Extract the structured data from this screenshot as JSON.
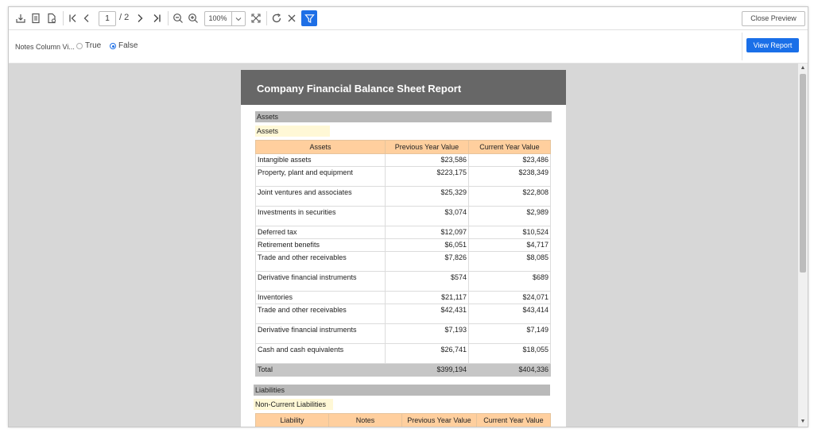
{
  "toolbar": {
    "page_current": "1",
    "page_total": "/ 2",
    "zoom": "100%",
    "close_preview": "Close Preview"
  },
  "parameters": {
    "label": "Notes Column Vi...",
    "option_true": "True",
    "option_false": "False",
    "selected": "False",
    "view_report": "View Report"
  },
  "report": {
    "title": "Company Financial Balance Sheet Report",
    "assets_section": "Assets",
    "assets_subsection": "Assets",
    "assets_columns": [
      "Assets",
      "Previous Year Value",
      "Current Year Value"
    ],
    "assets_rows": [
      {
        "name": "Intangible assets",
        "prev": "$23,586",
        "curr": "$23,486"
      },
      {
        "name": "Property, plant and equipment",
        "prev": "$223,175",
        "curr": "$238,349"
      },
      {
        "name": "Joint ventures and associates",
        "prev": "$25,329",
        "curr": "$22,808"
      },
      {
        "name": "Investments in securities",
        "prev": "$3,074",
        "curr": "$2,989"
      },
      {
        "name": "Deferred tax",
        "prev": "$12,097",
        "curr": "$10,524"
      },
      {
        "name": "Retirement benefits",
        "prev": "$6,051",
        "curr": "$4,717"
      },
      {
        "name": "Trade and other receivables",
        "prev": "$7,826",
        "curr": "$8,085"
      },
      {
        "name": "Derivative financial instruments",
        "prev": "$574",
        "curr": "$689"
      },
      {
        "name": "Inventories",
        "prev": "$21,117",
        "curr": "$24,071"
      },
      {
        "name": "Trade and other receivables",
        "prev": "$42,431",
        "curr": "$43,414"
      },
      {
        "name": "Derivative financial instruments",
        "prev": "$7,193",
        "curr": "$7,149"
      },
      {
        "name": "Cash and cash equivalents",
        "prev": "$26,741",
        "curr": "$18,055"
      }
    ],
    "assets_total": {
      "name": "Total",
      "prev": "$399,194",
      "curr": "$404,336"
    },
    "liabilities_section": "Liabilities",
    "liabilities_subsection": "Non-Current Liabilities",
    "liabilities_columns": [
      "Liability",
      "Notes",
      "Previous Year Value",
      "Current Year Value"
    ]
  },
  "icons": [
    "export-icon",
    "print-layout-icon",
    "page-setup-icon",
    "first-page-icon",
    "previous-page-icon",
    "next-page-icon",
    "last-page-icon",
    "zoom-out-icon",
    "zoom-in-icon",
    "fit-page-icon",
    "refresh-icon",
    "cancel-icon",
    "filter-icon"
  ],
  "colors": {
    "accent": "#1e6fe6",
    "report_header": "#676767",
    "table_header": "#ffcf9e",
    "section_bar": "#b9b9b9",
    "subsection_bg": "#fff8d6",
    "viewer_bg": "#d7d7d7"
  }
}
